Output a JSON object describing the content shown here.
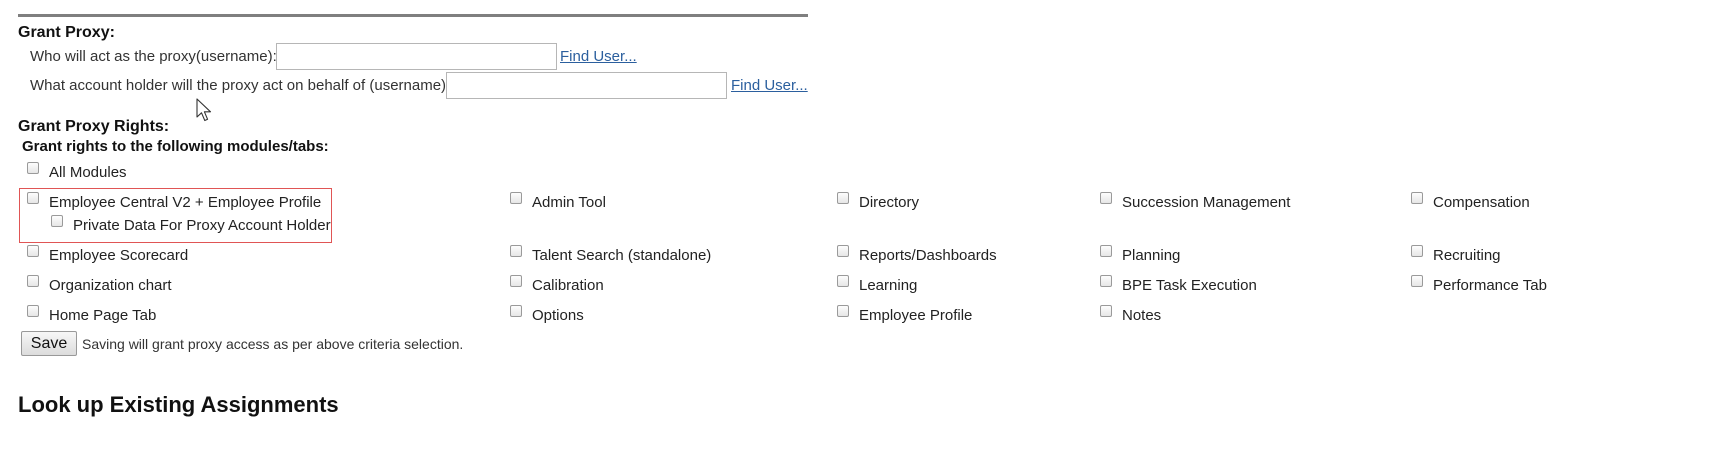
{
  "grant_proxy": {
    "heading": "Grant Proxy:",
    "proxy_label": "Who will act as the proxy(username):",
    "proxy_value": "",
    "account_label": "What account holder will the proxy act on behalf of (username):",
    "account_value": "",
    "find_user_1": "Find User...",
    "find_user_2": "Find User..."
  },
  "rights": {
    "heading": "Grant Proxy Rights:",
    "subheading": "Grant rights to the following modules/tabs:",
    "all_modules": "All Modules",
    "private_data": "Private Data For Proxy Account Holder",
    "modules": [
      "Employee Central V2 + Employee Profile",
      "Admin Tool",
      "Directory",
      "Succession Management",
      "Compensation",
      "Employee Scorecard",
      "Talent Search (standalone)",
      "Reports/Dashboards",
      "Planning",
      "Recruiting",
      "Organization chart",
      "Calibration",
      "Learning",
      "BPE Task Execution",
      "Performance Tab",
      "Home Page Tab",
      "Options",
      "Employee Profile",
      "Notes"
    ]
  },
  "save": {
    "label": "Save",
    "note": "Saving will grant proxy access as per above criteria selection."
  },
  "lookup": {
    "heading": "Look up Existing Assignments"
  }
}
